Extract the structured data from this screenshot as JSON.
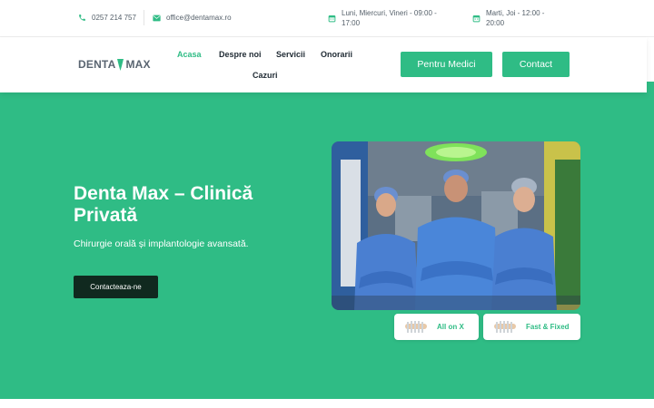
{
  "topbar": {
    "phone": "0257 214 757",
    "email": "office@dentamax.ro",
    "hours_1": "Luni, Miercuri, Vineri - 09:00 - 17:00",
    "hours_2": "Marti, Joi - 12:00 - 20:00"
  },
  "logo": {
    "left": "DENTA",
    "right": "MAX"
  },
  "nav": {
    "items": [
      "Acasa",
      "Despre noi",
      "Servicii",
      "Onorarii",
      "Cazuri"
    ],
    "active": "Acasa"
  },
  "header_buttons": {
    "medici": "Pentru Medici",
    "contact": "Contact"
  },
  "hero": {
    "title": "Denta Max – Clinică Privată",
    "subtitle": "Chirurgie orală și implantologie avansată.",
    "cta": "Contacteaza-ne"
  },
  "features": [
    {
      "label": "All on X",
      "icon": "dental-implant-row-icon"
    },
    {
      "label": "Fast & Fixed",
      "icon": "dental-implant-row-icon"
    }
  ],
  "colors": {
    "accent": "#2fbc85",
    "dark": "#10291f",
    "text": "#1f2a33",
    "muted": "#55606a"
  }
}
